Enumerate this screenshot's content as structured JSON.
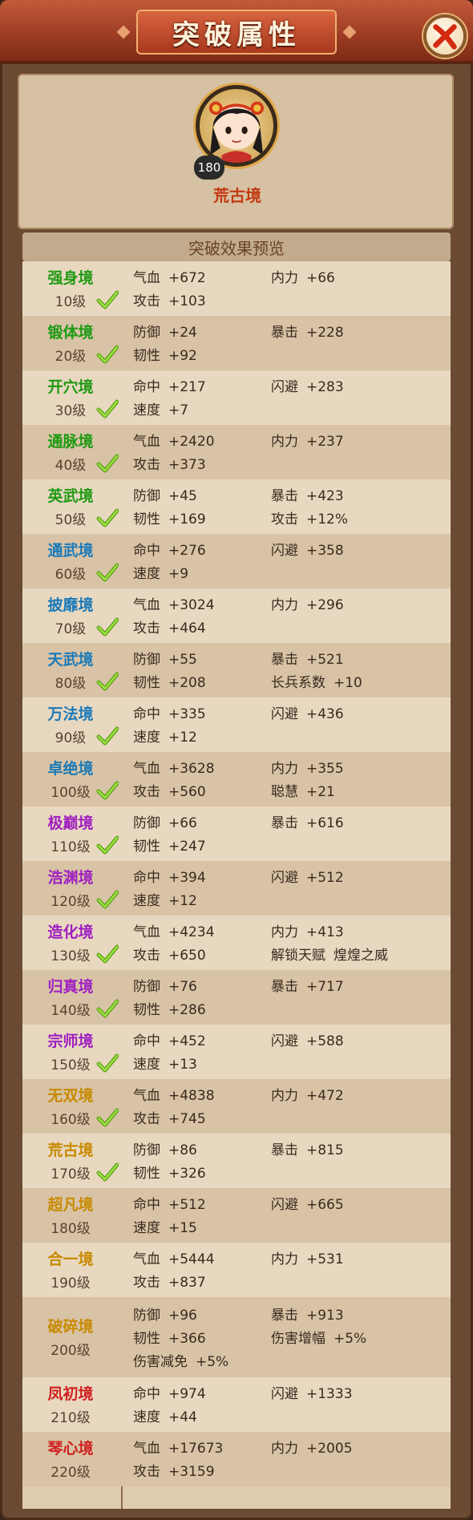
{
  "title": "突破属性",
  "avatar": {
    "level": "180",
    "realm": "荒古境"
  },
  "section_title": "突破效果预览",
  "rows": [
    {
      "name": "强身境",
      "level": "10级",
      "color": "#1e9a12",
      "done": true,
      "attrs": [
        [
          "气血",
          "+672"
        ],
        [
          "内力",
          "+66"
        ],
        [
          "攻击",
          "+103"
        ]
      ]
    },
    {
      "name": "锻体境",
      "level": "20级",
      "color": "#1e9a12",
      "done": true,
      "attrs": [
        [
          "防御",
          "+24"
        ],
        [
          "暴击",
          "+228"
        ],
        [
          "韧性",
          "+92"
        ]
      ]
    },
    {
      "name": "开穴境",
      "level": "30级",
      "color": "#1e9a12",
      "done": true,
      "attrs": [
        [
          "命中",
          "+217"
        ],
        [
          "闪避",
          "+283"
        ],
        [
          "速度",
          "+7"
        ]
      ]
    },
    {
      "name": "通脉境",
      "level": "40级",
      "color": "#1e9a12",
      "done": true,
      "attrs": [
        [
          "气血",
          "+2420"
        ],
        [
          "内力",
          "+237"
        ],
        [
          "攻击",
          "+373"
        ]
      ]
    },
    {
      "name": "英武境",
      "level": "50级",
      "color": "#1e9a12",
      "done": true,
      "attrs": [
        [
          "防御",
          "+45"
        ],
        [
          "暴击",
          "+423"
        ],
        [
          "韧性",
          "+169"
        ],
        [
          "攻击",
          "+12%"
        ]
      ]
    },
    {
      "name": "通武境",
      "level": "60级",
      "color": "#1a7ab8",
      "done": true,
      "attrs": [
        [
          "命中",
          "+276"
        ],
        [
          "闪避",
          "+358"
        ],
        [
          "速度",
          "+9"
        ]
      ]
    },
    {
      "name": "披靡境",
      "level": "70级",
      "color": "#1a7ab8",
      "done": true,
      "attrs": [
        [
          "气血",
          "+3024"
        ],
        [
          "内力",
          "+296"
        ],
        [
          "攻击",
          "+464"
        ]
      ]
    },
    {
      "name": "天武境",
      "level": "80级",
      "color": "#1a7ab8",
      "done": true,
      "attrs": [
        [
          "防御",
          "+55"
        ],
        [
          "暴击",
          "+521"
        ],
        [
          "韧性",
          "+208"
        ],
        [
          "长兵系数",
          "+10"
        ]
      ]
    },
    {
      "name": "万法境",
      "level": "90级",
      "color": "#1a7ab8",
      "done": true,
      "attrs": [
        [
          "命中",
          "+335"
        ],
        [
          "闪避",
          "+436"
        ],
        [
          "速度",
          "+12"
        ]
      ]
    },
    {
      "name": "卓绝境",
      "level": "100级",
      "color": "#1a7ab8",
      "done": true,
      "attrs": [
        [
          "气血",
          "+3628"
        ],
        [
          "内力",
          "+355"
        ],
        [
          "攻击",
          "+560"
        ],
        [
          "聪慧",
          "+21"
        ]
      ]
    },
    {
      "name": "极巅境",
      "level": "110级",
      "color": "#a020c0",
      "done": true,
      "attrs": [
        [
          "防御",
          "+66"
        ],
        [
          "暴击",
          "+616"
        ],
        [
          "韧性",
          "+247"
        ]
      ]
    },
    {
      "name": "浩渊境",
      "level": "120级",
      "color": "#a020c0",
      "done": true,
      "attrs": [
        [
          "命中",
          "+394"
        ],
        [
          "闪避",
          "+512"
        ],
        [
          "速度",
          "+12"
        ]
      ]
    },
    {
      "name": "造化境",
      "level": "130级",
      "color": "#a020c0",
      "done": true,
      "attrs": [
        [
          "气血",
          "+4234"
        ],
        [
          "内力",
          "+413"
        ],
        [
          "攻击",
          "+650"
        ],
        [
          "解锁天赋",
          "煌煌之威"
        ]
      ]
    },
    {
      "name": "归真境",
      "level": "140级",
      "color": "#a020c0",
      "done": true,
      "attrs": [
        [
          "防御",
          "+76"
        ],
        [
          "暴击",
          "+717"
        ],
        [
          "韧性",
          "+286"
        ]
      ]
    },
    {
      "name": "宗师境",
      "level": "150级",
      "color": "#a020c0",
      "done": true,
      "attrs": [
        [
          "命中",
          "+452"
        ],
        [
          "闪避",
          "+588"
        ],
        [
          "速度",
          "+13"
        ]
      ]
    },
    {
      "name": "无双境",
      "level": "160级",
      "color": "#c88a00",
      "done": true,
      "attrs": [
        [
          "气血",
          "+4838"
        ],
        [
          "内力",
          "+472"
        ],
        [
          "攻击",
          "+745"
        ]
      ]
    },
    {
      "name": "荒古境",
      "level": "170级",
      "color": "#c88a00",
      "done": true,
      "attrs": [
        [
          "防御",
          "+86"
        ],
        [
          "暴击",
          "+815"
        ],
        [
          "韧性",
          "+326"
        ]
      ]
    },
    {
      "name": "超凡境",
      "level": "180级",
      "color": "#c88a00",
      "done": false,
      "attrs": [
        [
          "命中",
          "+512"
        ],
        [
          "闪避",
          "+665"
        ],
        [
          "速度",
          "+15"
        ]
      ]
    },
    {
      "name": "合一境",
      "level": "190级",
      "color": "#c88a00",
      "done": false,
      "attrs": [
        [
          "气血",
          "+5444"
        ],
        [
          "内力",
          "+531"
        ],
        [
          "攻击",
          "+837"
        ]
      ]
    },
    {
      "name": "破碎境",
      "level": "200级",
      "color": "#c88a00",
      "done": false,
      "attrs": [
        [
          "防御",
          "+96"
        ],
        [
          "暴击",
          "+913"
        ],
        [
          "韧性",
          "+366"
        ],
        [
          "伤害增幅",
          "+5%"
        ],
        [
          "伤害减免",
          "+5%"
        ]
      ]
    },
    {
      "name": "凤初境",
      "level": "210级",
      "color": "#d02020",
      "done": false,
      "attrs": [
        [
          "命中",
          "+974"
        ],
        [
          "闪避",
          "+1333"
        ],
        [
          "速度",
          "+44"
        ]
      ]
    },
    {
      "name": "琴心境",
      "level": "220级",
      "color": "#d02020",
      "done": false,
      "attrs": [
        [
          "气血",
          "+17673"
        ],
        [
          "内力",
          "+2005"
        ],
        [
          "攻击",
          "+3159"
        ]
      ]
    }
  ]
}
